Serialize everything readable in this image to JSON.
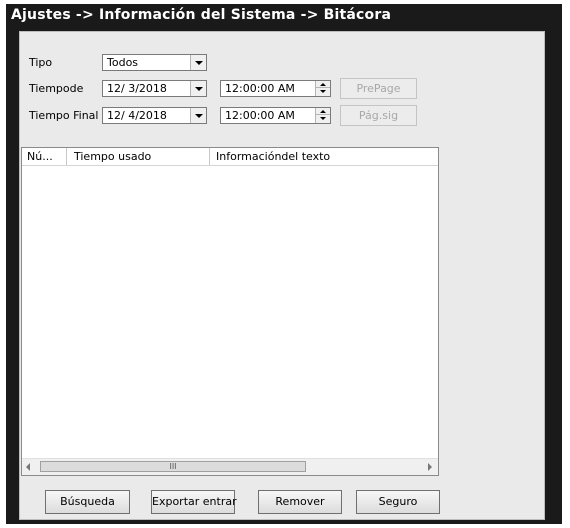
{
  "title": "Ajustes -> Información del Sistema -> Bitácora",
  "filters": {
    "tipo_label": "Tipo",
    "tipo_value": "Todos",
    "start_label": "Tiempode",
    "start_date": "12/ 3/2018",
    "start_time": "12:00:00 AM",
    "end_label": "Tiempo Final",
    "end_date": "12/ 4/2018",
    "end_time": "12:00:00 AM"
  },
  "paging": {
    "prev_label": "PrePage",
    "next_label": "Pág.sig"
  },
  "log_table": {
    "columns": [
      "Nú...",
      "Tiempo usado",
      "Informacióndel texto"
    ],
    "rows": []
  },
  "scroll_thumb_grip": "III",
  "buttons": {
    "search": "Búsqueda",
    "export": "Exportar entrar",
    "remove": "Remover",
    "secure": "Seguro"
  },
  "colors": {
    "title_bar": "#1a1a1a",
    "title_text": "#ffffff",
    "panel": "#eaeaea"
  }
}
